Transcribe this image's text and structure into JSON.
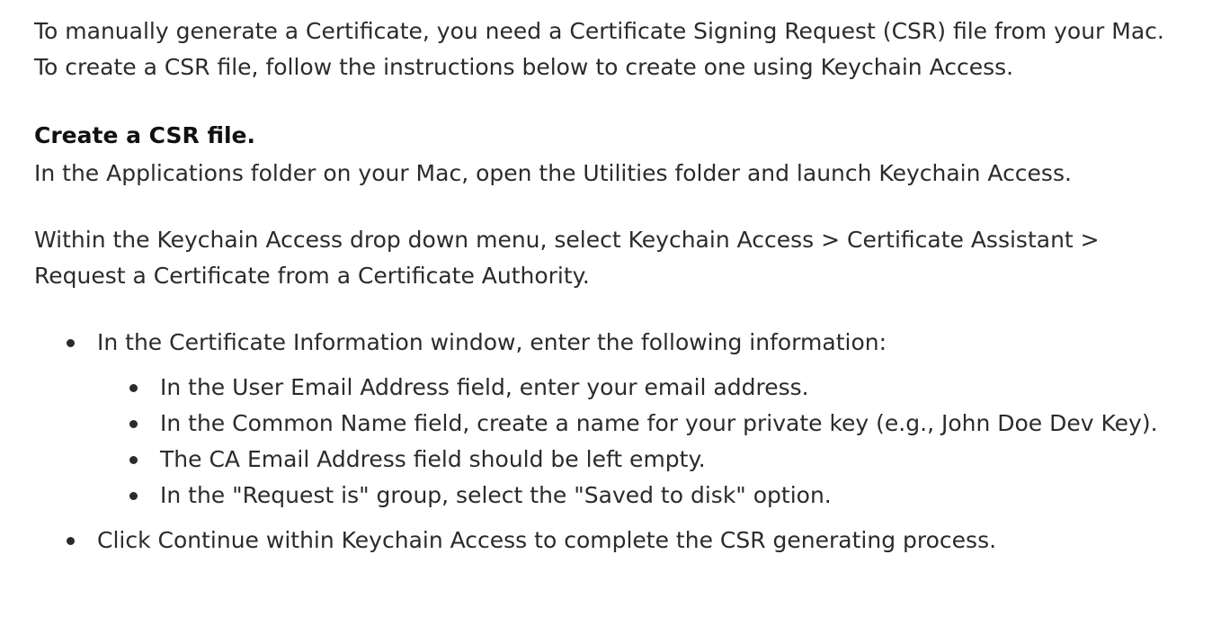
{
  "intro": "To manually generate a Certificate, you need a Certificate Signing Request (CSR) file from your Mac. To create a CSR file, follow the instructions below to create one using Keychain Access.",
  "heading": "Create a CSR file.",
  "step1": "In the Applications folder on your Mac, open the Utilities folder and launch Keychain Access.",
  "step2": "Within the Keychain Access drop down menu, select Keychain Access > Certificate Assistant > Request a Certificate from a Certificate Authority.",
  "bullets": [
    {
      "text": "In the Certificate Information window, enter the following information:",
      "sub": [
        "In the User Email Address field, enter your email address.",
        "In the Common Name field, create a name for your private key (e.g., John Doe Dev Key).",
        "The CA Email Address field should be left empty.",
        "In the \"Request is\" group, select the \"Saved to disk\" option."
      ]
    },
    {
      "text": "Click Continue within Keychain Access to complete the CSR generating process."
    }
  ]
}
